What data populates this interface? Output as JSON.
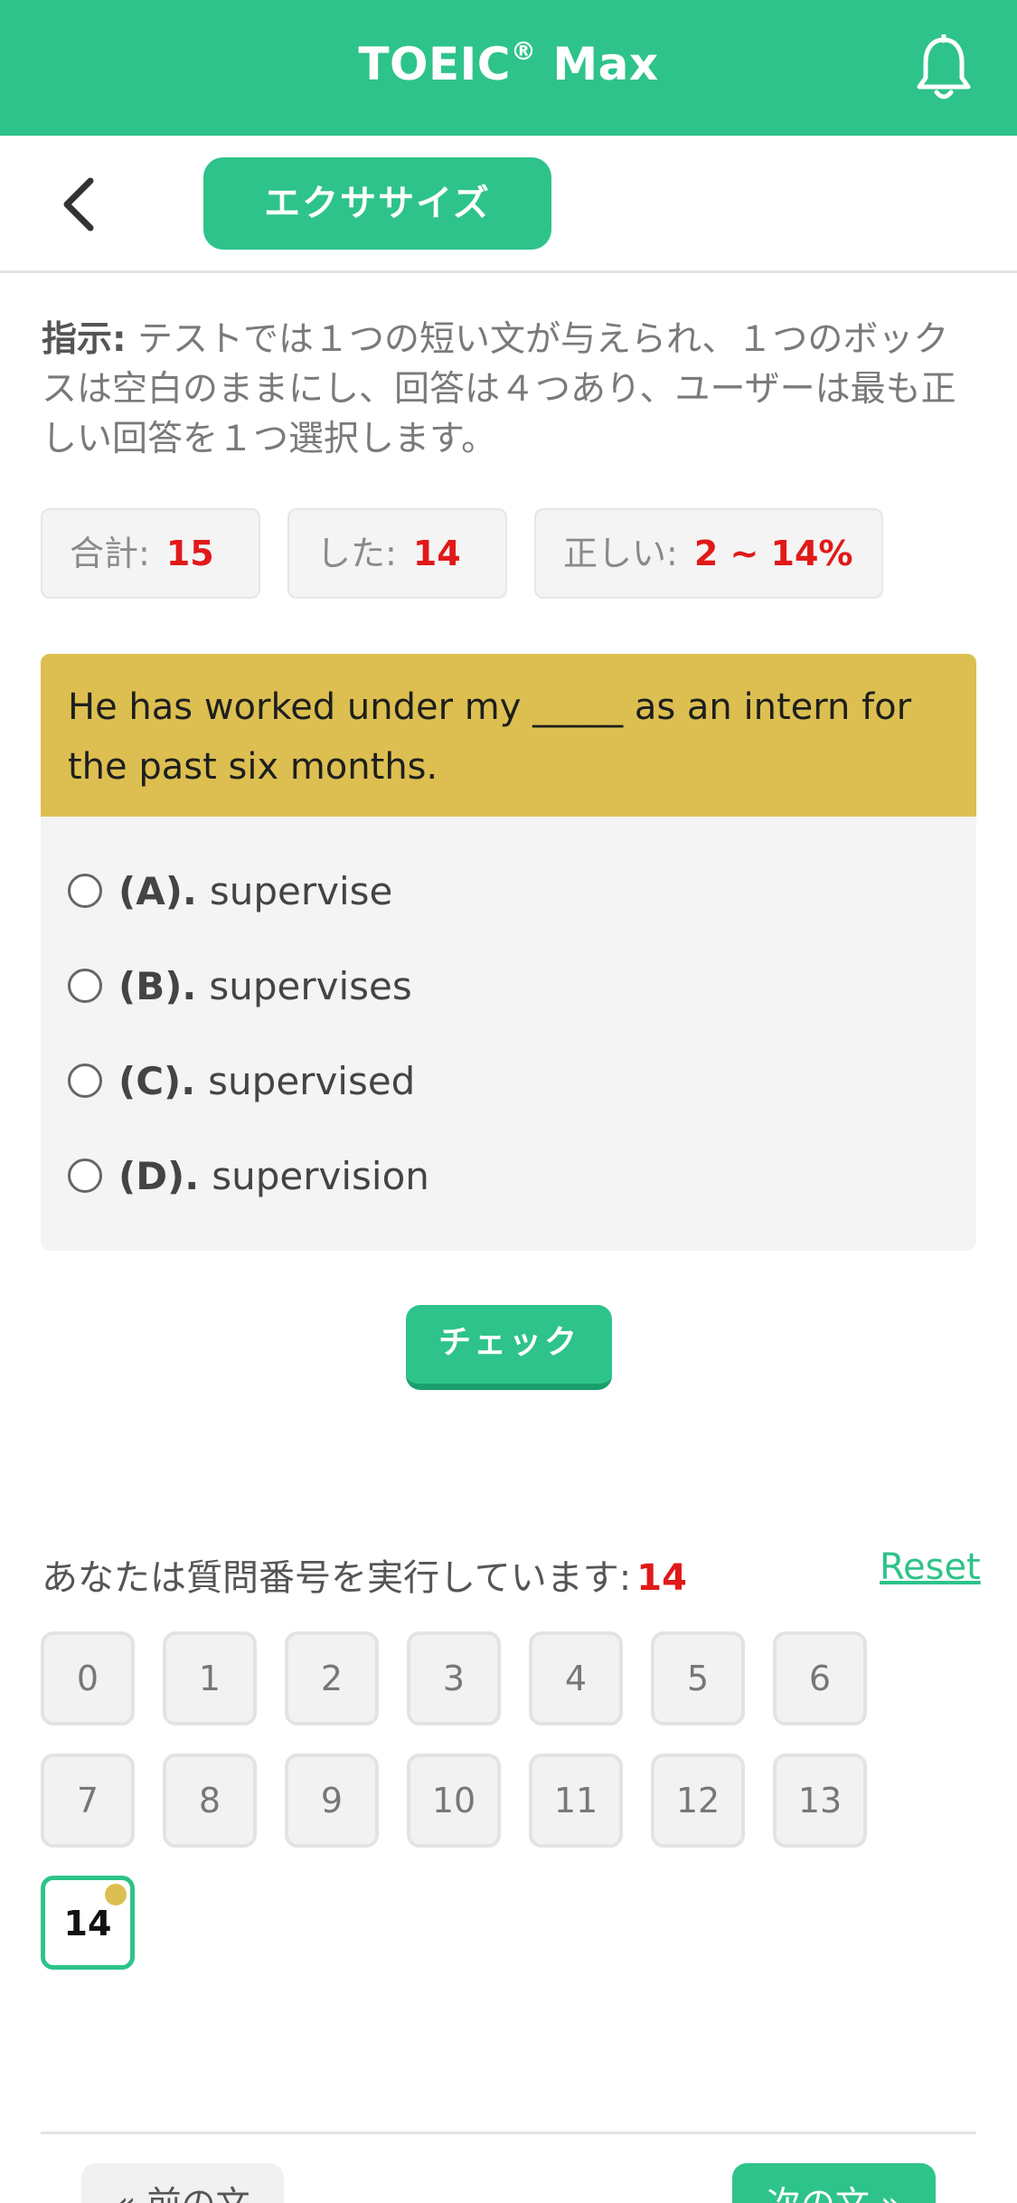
{
  "app": {
    "title": "TOEIC",
    "title_mark": "®",
    "title_suffix": " Max"
  },
  "header": {
    "mode_label": "エクササイズ"
  },
  "instruction": {
    "label": "指示:",
    "text": " テストでは１つの短い文が与えられ、１つのボックスは空白のままにし、回答は４つあり、ユーザーは最も正しい回答を１つ選択します。"
  },
  "stats": {
    "total_label": "合計:",
    "total_value": "15",
    "done_label": "した:",
    "done_value": "14",
    "correct_label": "正しい:",
    "correct_value": "2 ~ 14%"
  },
  "question": {
    "text": "He has worked under my _____ as an intern for the past six months.",
    "options": [
      {
        "key": "(A).",
        "text": "supervise"
      },
      {
        "key": "(B).",
        "text": "supervises"
      },
      {
        "key": "(C).",
        "text": "supervised"
      },
      {
        "key": "(D).",
        "text": "supervision"
      }
    ]
  },
  "check_label": "チェック",
  "progress": {
    "label": "あなたは質問番号を実行しています:",
    "current": "14",
    "reset_label": "Reset",
    "numbers": [
      "0",
      "1",
      "2",
      "3",
      "4",
      "5",
      "6",
      "7",
      "8",
      "9",
      "10",
      "11",
      "12",
      "13",
      "14"
    ]
  },
  "footer": {
    "prev_label": "« 前の文",
    "next_label": "次の文 »"
  },
  "colors": {
    "primary": "#2ec38a",
    "question_bg": "#dcbf50",
    "highlight": "#e11919"
  }
}
